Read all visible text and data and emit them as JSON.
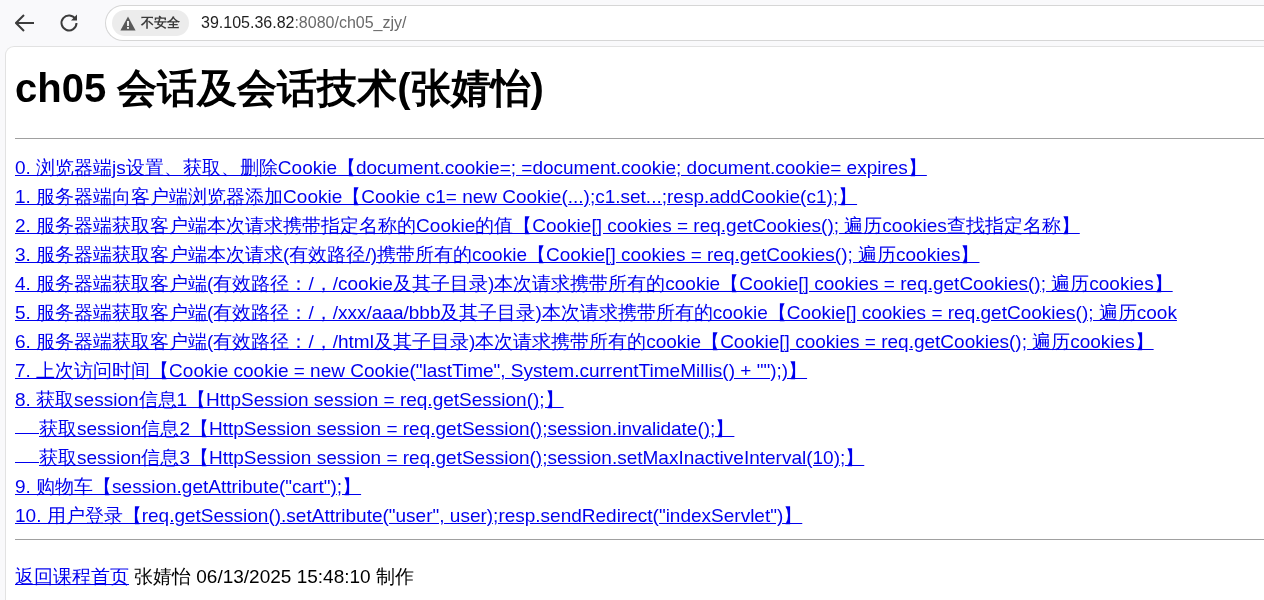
{
  "browser": {
    "security_label": "不安全",
    "url_host": "39.105.36.82",
    "url_path": ":8080/ch05_zjy/"
  },
  "page": {
    "heading": "ch05 会话及会话技术(张婧怡)",
    "links": [
      {
        "text": "0. 浏览器端js设置、获取、删除Cookie【document.cookie=; =document.cookie; document.cookie= expires】"
      },
      {
        "text": "1. 服务器端向客户端浏览器添加Cookie【Cookie c1= new Cookie(...);c1.set...;resp.addCookie(c1);】"
      },
      {
        "text": "2. 服务器端获取客户端本次请求携带指定名称的Cookie的值【Cookie[] cookies = req.getCookies(); 遍历cookies查找指定名称】"
      },
      {
        "text": "3. 服务器端获取客户端本次请求(有效路径/)携带所有的cookie【Cookie[] cookies = req.getCookies(); 遍历cookies】"
      },
      {
        "text": "4. 服务器端获取客户端(有效路径：/，/cookie及其子目录)本次请求携带所有的cookie【Cookie[] cookies = req.getCookies(); 遍历cookies】"
      },
      {
        "text": "5. 服务器端获取客户端(有效路径：/，/xxx/aaa/bbb及其子目录)本次请求携带所有的cookie【Cookie[] cookies = req.getCookies(); 遍历cook"
      },
      {
        "text": "6. 服务器端获取客户端(有效路径：/，/html及其子目录)本次请求携带所有的cookie【Cookie[] cookies = req.getCookies(); 遍历cookies】"
      },
      {
        "text": "7. 上次访问时间【Cookie cookie = new Cookie(\"lastTime\", System.currentTimeMillis() + \"\");)】"
      },
      {
        "text": "8. 获取session信息1【HttpSession session = req.getSession();】",
        "children": [
          {
            "text": "获取session信息2【HttpSession session = req.getSession();session.invalidate();】"
          },
          {
            "text": "获取session信息3【HttpSession session = req.getSession();session.setMaxInactiveInterval(10);】"
          }
        ]
      },
      {
        "text": "9. 购物车【session.getAttribute(\"cart\");】"
      },
      {
        "text": "10. 用户登录【req.getSession().setAttribute(\"user\", user);resp.sendRedirect(\"indexServlet\")】"
      }
    ],
    "footer": {
      "link": "返回课程首页",
      "text": "张婧怡 06/13/2025 15:48:10 制作"
    }
  }
}
